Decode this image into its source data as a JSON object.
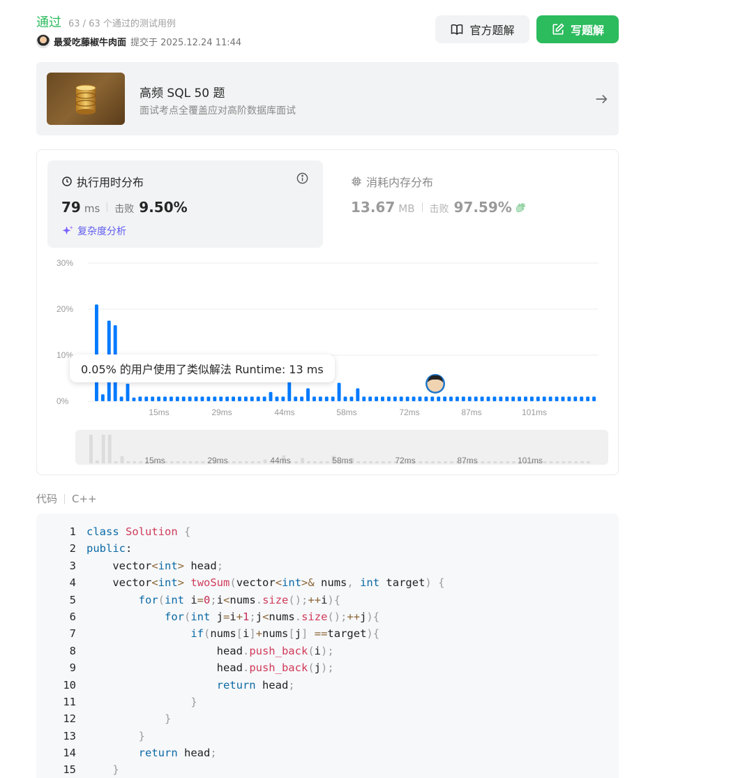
{
  "header": {
    "status": "通过",
    "cases": "63 / 63 个通过的测试用例",
    "user": "最爱吃藤椒牛肉面",
    "submitted": "提交于 2025.12.24 11:44",
    "official_btn": "官方题解",
    "write_btn": "写题解"
  },
  "banner": {
    "title": "高频 SQL 50 题",
    "subtitle": "面试考点全覆盖应对高阶数据库面试"
  },
  "runtime": {
    "title": "执行用时分布",
    "value": "79",
    "unit": "ms",
    "beat_label": "击败",
    "beat": "9.50%",
    "complexity": "复杂度分析"
  },
  "memory": {
    "title": "消耗内存分布",
    "value": "13.67",
    "unit": "MB",
    "beat_label": "击败",
    "beat": "97.59%"
  },
  "tooltip": "0.05% 的用户使用了类似解法 Runtime: 13 ms",
  "chart_data": {
    "type": "bar",
    "ylim": [
      0,
      30
    ],
    "y_ticks": [
      "30%",
      "20%",
      "10%",
      "0%"
    ],
    "x_ticks": [
      "15ms",
      "29ms",
      "44ms",
      "58ms",
      "72ms",
      "87ms",
      "101ms"
    ],
    "grid": true,
    "legend": "none",
    "bar_color": "#007aff",
    "values": [
      21,
      1.5,
      17.5,
      16.5,
      1,
      3.8,
      0.8,
      1,
      1,
      1,
      1,
      1,
      1,
      1,
      1,
      1,
      1,
      1,
      1,
      1,
      1,
      1,
      1,
      1,
      1,
      1,
      1,
      1,
      2,
      1,
      1,
      4.2,
      1,
      1,
      2.8,
      1,
      1,
      1,
      1,
      4,
      1,
      1,
      2.8,
      1,
      1,
      1,
      1,
      1,
      1,
      1,
      1,
      1,
      1,
      1,
      1,
      1,
      1,
      1,
      1,
      1,
      1,
      1,
      1,
      1,
      1,
      1,
      1,
      1,
      1,
      1,
      1,
      1,
      1,
      1,
      1,
      1,
      1,
      1,
      1,
      1,
      1
    ]
  },
  "code": {
    "label": "代码",
    "lang": "C++",
    "lines": [
      [
        [
          "kw",
          "class"
        ],
        [
          "t",
          " "
        ],
        [
          "cls",
          "Solution"
        ],
        [
          "t",
          " "
        ],
        [
          "p",
          "{"
        ]
      ],
      [
        [
          "kw",
          "public"
        ],
        [
          "t",
          ":"
        ]
      ],
      [
        [
          "t",
          "    vector"
        ],
        [
          "op",
          "<"
        ],
        [
          "kw",
          "int"
        ],
        [
          "op",
          ">"
        ],
        [
          "t",
          " head"
        ],
        [
          "p",
          ";"
        ]
      ],
      [
        [
          "t",
          "    vector"
        ],
        [
          "op",
          "<"
        ],
        [
          "kw",
          "int"
        ],
        [
          "op",
          ">"
        ],
        [
          "t",
          " "
        ],
        [
          "fn",
          "twoSum"
        ],
        [
          "p",
          "("
        ],
        [
          "t",
          "vector"
        ],
        [
          "op",
          "<"
        ],
        [
          "kw",
          "int"
        ],
        [
          "op",
          ">&"
        ],
        [
          "t",
          " nums"
        ],
        [
          "p",
          ","
        ],
        [
          "t",
          " "
        ],
        [
          "kw",
          "int"
        ],
        [
          "t",
          " target"
        ],
        [
          "p",
          ")"
        ],
        [
          "t",
          " "
        ],
        [
          "p",
          "{"
        ]
      ],
      [
        [
          "t",
          "        "
        ],
        [
          "kw",
          "for"
        ],
        [
          "p",
          "("
        ],
        [
          "kw",
          "int"
        ],
        [
          "t",
          " i"
        ],
        [
          "op",
          "="
        ],
        [
          "num",
          "0"
        ],
        [
          "p",
          ";"
        ],
        [
          "t",
          "i"
        ],
        [
          "op",
          "<"
        ],
        [
          "t",
          "nums"
        ],
        [
          "p",
          "."
        ],
        [
          "fn",
          "size"
        ],
        [
          "p",
          "();"
        ],
        [
          "op",
          "++"
        ],
        [
          "t",
          "i"
        ],
        [
          "p",
          "){"
        ]
      ],
      [
        [
          "t",
          "            "
        ],
        [
          "kw",
          "for"
        ],
        [
          "p",
          "("
        ],
        [
          "kw",
          "int"
        ],
        [
          "t",
          " j"
        ],
        [
          "op",
          "="
        ],
        [
          "t",
          "i"
        ],
        [
          "op",
          "+"
        ],
        [
          "num",
          "1"
        ],
        [
          "p",
          ";"
        ],
        [
          "t",
          "j"
        ],
        [
          "op",
          "<"
        ],
        [
          "t",
          "nums"
        ],
        [
          "p",
          "."
        ],
        [
          "fn",
          "size"
        ],
        [
          "p",
          "();"
        ],
        [
          "op",
          "++"
        ],
        [
          "t",
          "j"
        ],
        [
          "p",
          "){"
        ]
      ],
      [
        [
          "t",
          "                "
        ],
        [
          "kw",
          "if"
        ],
        [
          "p",
          "("
        ],
        [
          "t",
          "nums"
        ],
        [
          "p",
          "["
        ],
        [
          "t",
          "i"
        ],
        [
          "p",
          "]"
        ],
        [
          "op",
          "+"
        ],
        [
          "t",
          "nums"
        ],
        [
          "p",
          "["
        ],
        [
          "t",
          "j"
        ],
        [
          "p",
          "]"
        ],
        [
          "t",
          " "
        ],
        [
          "op",
          "=="
        ],
        [
          "t",
          "target"
        ],
        [
          "p",
          "){"
        ]
      ],
      [
        [
          "t",
          "                    head"
        ],
        [
          "p",
          "."
        ],
        [
          "fn",
          "push_back"
        ],
        [
          "p",
          "("
        ],
        [
          "t",
          "i"
        ],
        [
          "p",
          ");"
        ]
      ],
      [
        [
          "t",
          "                    head"
        ],
        [
          "p",
          "."
        ],
        [
          "fn",
          "push_back"
        ],
        [
          "p",
          "("
        ],
        [
          "t",
          "j"
        ],
        [
          "p",
          ");"
        ]
      ],
      [
        [
          "t",
          "                    "
        ],
        [
          "kw",
          "return"
        ],
        [
          "t",
          " head"
        ],
        [
          "p",
          ";"
        ]
      ],
      [
        [
          "t",
          "                "
        ],
        [
          "p",
          "}"
        ]
      ],
      [
        [
          "t",
          "            "
        ],
        [
          "p",
          "}"
        ]
      ],
      [
        [
          "t",
          "        "
        ],
        [
          "p",
          "}"
        ]
      ],
      [
        [
          "t",
          "        "
        ],
        [
          "kw",
          "return"
        ],
        [
          "t",
          " head"
        ],
        [
          "p",
          ";"
        ]
      ],
      [
        [
          "t",
          "    "
        ],
        [
          "p",
          "}"
        ]
      ]
    ]
  }
}
